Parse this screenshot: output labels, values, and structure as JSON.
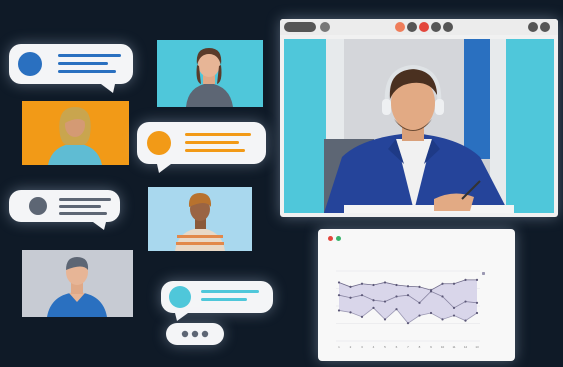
{
  "chart_data": {
    "type": "area",
    "title": "",
    "xlabel": "",
    "ylabel": "",
    "categories": [
      "1",
      "2",
      "3",
      "4",
      "5",
      "6",
      "7",
      "8",
      "9",
      "10",
      "11",
      "12",
      "13"
    ],
    "series": [
      {
        "name": "",
        "values": [
          92,
          85,
          90,
          88,
          92,
          88,
          86,
          85,
          80,
          90,
          90,
          96,
          96
        ]
      },
      {
        "name": "",
        "values": [
          72,
          68,
          72,
          64,
          62,
          70,
          72,
          60,
          78,
          70,
          52,
          62,
          60
        ]
      },
      {
        "name": "",
        "values": [
          48,
          45,
          38,
          52,
          34,
          50,
          28,
          40,
          44,
          34,
          40,
          32,
          44
        ]
      }
    ],
    "ylim": [
      0,
      110
    ],
    "grid": true,
    "colors": {
      "fill": "#d9d6ea",
      "upper_line": "#6f6a8a",
      "mid_line": "#8a86a3",
      "lower_line": "#9b98b3",
      "points": "#5b5777",
      "grid": "#e2e2e6"
    }
  },
  "colors": {
    "background": "#0f1a27",
    "bubble": "#f4f5f7",
    "accent_blue": "#2a70c0",
    "accent_orange": "#f29a17",
    "accent_grey": "#5d6674",
    "accent_cyan": "#4fc7da",
    "end_call_red": "#e3463c"
  },
  "icons": {
    "typing": "typing-dots-icon",
    "mic": "microphone-icon",
    "camera": "camera-icon",
    "end_call": "end-call-icon",
    "share": "share-screen-icon",
    "settings": "gear-icon"
  }
}
